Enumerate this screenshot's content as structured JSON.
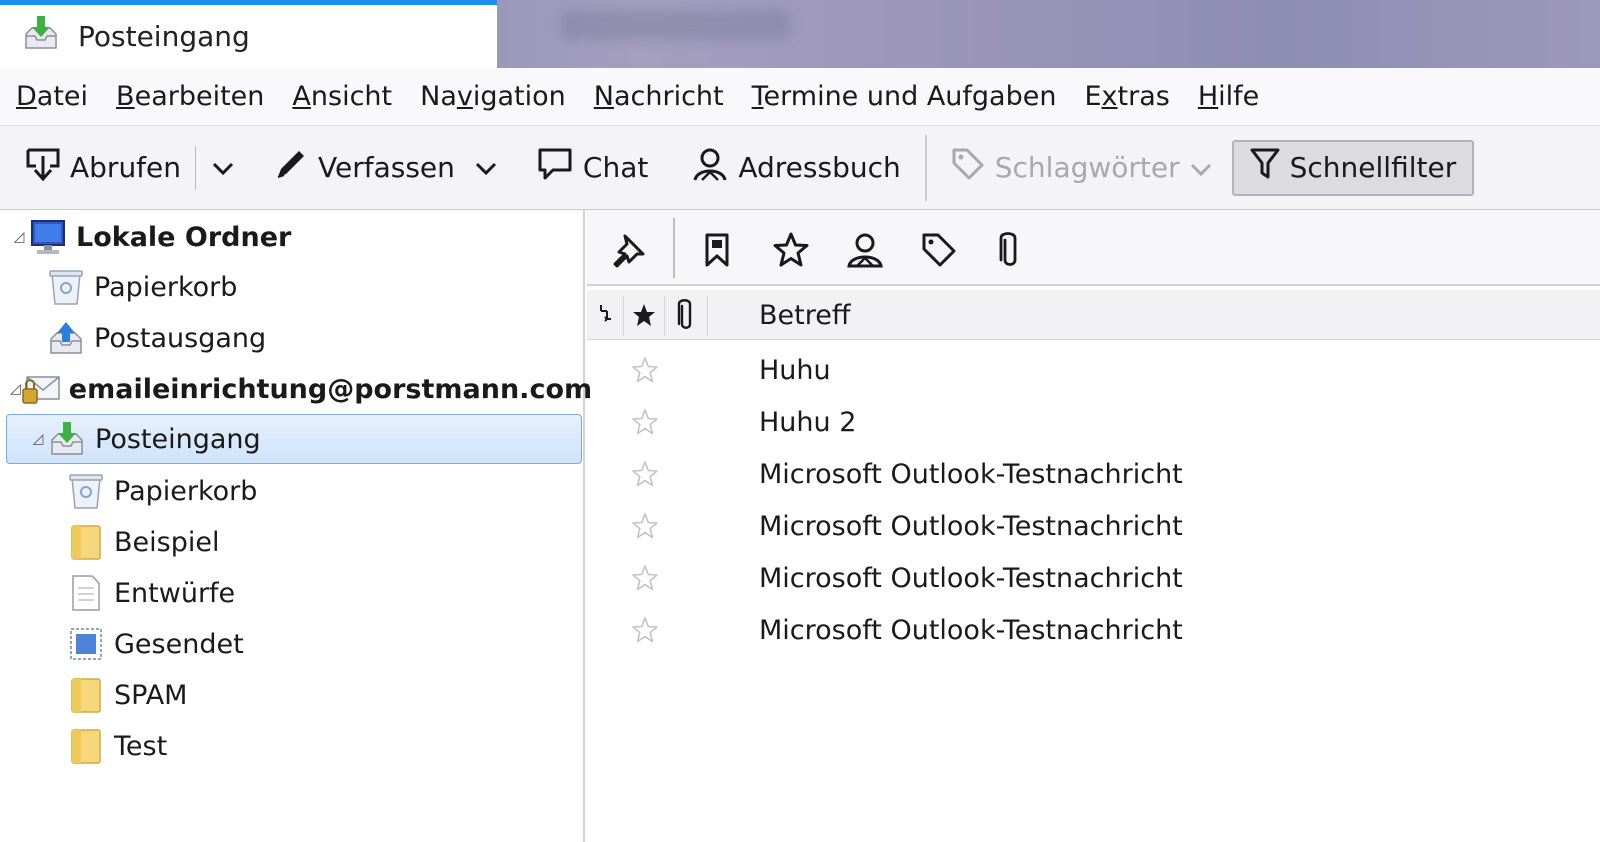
{
  "tab": {
    "title": "Posteingang",
    "icon": "inbox-icon"
  },
  "menu": [
    {
      "pre": "",
      "u": "D",
      "post": "atei"
    },
    {
      "pre": "",
      "u": "B",
      "post": "earbeiten"
    },
    {
      "pre": "",
      "u": "A",
      "post": "nsicht"
    },
    {
      "pre": "Na",
      "u": "v",
      "post": "igation"
    },
    {
      "pre": "",
      "u": "N",
      "post": "achricht"
    },
    {
      "pre": "",
      "u": "T",
      "post": "ermine und Aufgaben"
    },
    {
      "pre": "E",
      "u": "x",
      "post": "tras"
    },
    {
      "pre": "",
      "u": "H",
      "post": "ilfe"
    }
  ],
  "toolbar": {
    "get_label": "Abrufen",
    "write_label": "Verfassen",
    "chat_label": "Chat",
    "addressbook_label": "Adressbuch",
    "tags_label": "Schlagwörter",
    "quickfilter_label": "Schnellfilter"
  },
  "folders": {
    "local_label": "Lokale Ordner",
    "local_trash": "Papierkorb",
    "local_outbox": "Postausgang",
    "account_label": "emaileinrichtung@porstmann.com",
    "inbox": "Posteingang",
    "trash": "Papierkorb",
    "example": "Beispiel",
    "drafts": "Entwürfe",
    "sent": "Gesendet",
    "spam": "SPAM",
    "test": "Test"
  },
  "columns": {
    "subject": "Betreff"
  },
  "messages": [
    {
      "subject": "Huhu",
      "starred": false
    },
    {
      "subject": "Huhu 2",
      "starred": false
    },
    {
      "subject": "Microsoft Outlook-Testnachricht",
      "starred": false
    },
    {
      "subject": "Microsoft Outlook-Testnachricht",
      "starred": false
    },
    {
      "subject": "Microsoft Outlook-Testnachricht",
      "starred": false
    },
    {
      "subject": "Microsoft Outlook-Testnachricht",
      "starred": false
    }
  ],
  "colors": {
    "accent": "#1e8ef0",
    "selection": "#cfe3fb",
    "selection_border": "#7ea9e0"
  }
}
